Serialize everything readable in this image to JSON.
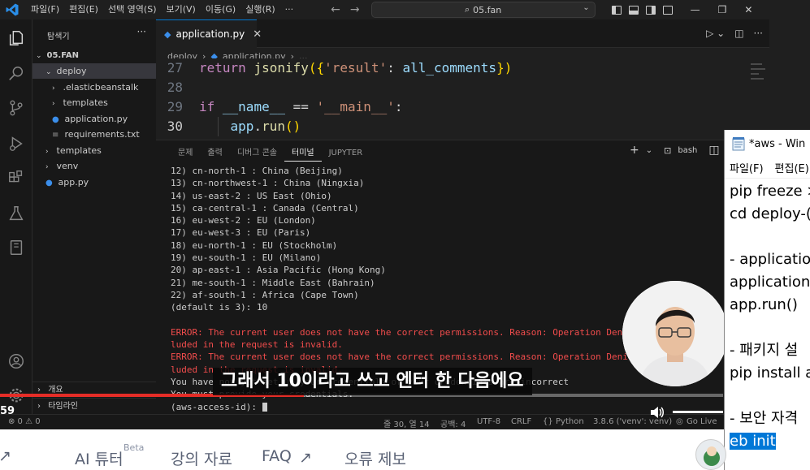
{
  "titlebar": {
    "menu": [
      "파일(F)",
      "편집(E)",
      "선택 영역(S)",
      "보기(V)",
      "이동(G)",
      "실행(R)",
      "···"
    ],
    "search": "05.fan",
    "colors": {
      "background": "#1f1f1f"
    }
  },
  "activity_icons": [
    "explorer-icon",
    "search-icon",
    "source-control-icon",
    "run-debug-icon",
    "extensions-icon",
    "testing-icon",
    "notebook-icon",
    "accounts-icon",
    "settings-gear-icon"
  ],
  "sidebar": {
    "title": "탐색기",
    "more": "···",
    "root": "05.FAN",
    "items": [
      {
        "label": "deploy",
        "type": "folder-open"
      },
      {
        "label": ".elasticbeanstalk",
        "type": "folder"
      },
      {
        "label": "templates",
        "type": "folder"
      },
      {
        "label": "application.py",
        "type": "python"
      },
      {
        "label": "requirements.txt",
        "type": "text"
      },
      {
        "label": "templates",
        "type": "folder"
      },
      {
        "label": "venv",
        "type": "folder"
      },
      {
        "label": "app.py",
        "type": "python"
      }
    ],
    "outline": "개요",
    "timeline": "타임라인"
  },
  "editor": {
    "tab_label": "application.py",
    "tab_icon": "python-icon",
    "breadcrumb": [
      "deploy",
      "application.py",
      "..."
    ],
    "lines": [
      {
        "num": "27",
        "parts": [
          [
            "kw",
            "return "
          ],
          [
            "fn",
            "jsonify"
          ],
          [
            "br",
            "({"
          ],
          [
            "st",
            "'result'"
          ],
          [
            "pl",
            ": "
          ],
          [
            "vr",
            "all_comments"
          ],
          [
            "br",
            "})"
          ]
        ]
      },
      {
        "num": "28",
        "parts": []
      },
      {
        "num": "29",
        "parts": [
          [
            "kw",
            "if "
          ],
          [
            "vr",
            "__name__"
          ],
          [
            "pl",
            " == "
          ],
          [
            "st",
            "'__main__'"
          ],
          [
            "pl",
            ":"
          ]
        ]
      },
      {
        "num": "30",
        "parts": [
          [
            "pl",
            "    "
          ],
          [
            "vr",
            "app"
          ],
          [
            "pl",
            "."
          ],
          [
            "fn",
            "run"
          ],
          [
            "br",
            "()"
          ]
        ]
      }
    ]
  },
  "panel": {
    "tabs": [
      "문제",
      "출력",
      "디버그 콘솔",
      "터미널",
      "JUPYTER"
    ],
    "active_tab": "터미널",
    "shell": "bash",
    "terminal_lines": [
      {
        "t": "12) cn-north-1 : China (Beijing)",
        "c": "n"
      },
      {
        "t": "13) cn-northwest-1 : China (Ningxia)",
        "c": "n"
      },
      {
        "t": "14) us-east-2 : US East (Ohio)",
        "c": "n"
      },
      {
        "t": "15) ca-central-1 : Canada (Central)",
        "c": "n"
      },
      {
        "t": "16) eu-west-2 : EU (London)",
        "c": "n"
      },
      {
        "t": "17) eu-west-3 : EU (Paris)",
        "c": "n"
      },
      {
        "t": "18) eu-north-1 : EU (Stockholm)",
        "c": "n"
      },
      {
        "t": "19) eu-south-1 : EU (Milano)",
        "c": "n"
      },
      {
        "t": "20) ap-east-1 : Asia Pacific (Hong Kong)",
        "c": "n"
      },
      {
        "t": "21) me-south-1 : Middle East (Bahrain)",
        "c": "n"
      },
      {
        "t": "22) af-south-1 : Africa (Cape Town)",
        "c": "n"
      },
      {
        "t": "(default is 3): 10",
        "c": "n"
      },
      {
        "t": "",
        "c": "n"
      },
      {
        "t": "ERROR: The current user does not have the correct permissions. Reason: Operation Denied",
        "c": "err"
      },
      {
        "t": "luded in the request is invalid.",
        "c": "err"
      },
      {
        "t": "ERROR: The current user does not have the correct permissions. Reason: Operation Denied",
        "c": "err"
      },
      {
        "t": "luded in the request is invalid.",
        "c": "err"
      },
      {
        "t": "You have not yet set up your credentials or your credentials are incorrect",
        "c": "n"
      },
      {
        "t": "You must provide your credentials.",
        "c": "n"
      },
      {
        "t": "(aws-access-id): ",
        "c": "n"
      }
    ]
  },
  "statusbar": {
    "problems": "⊗ 0 ⚠ 0",
    "position": "줄 30, 열 14",
    "spaces": "공백: 4",
    "encoding": "UTF-8",
    "eol": "CRLF",
    "language": "Python",
    "interpreter": "3.8.6 ('venv': venv)",
    "golive": "Go Live"
  },
  "video": {
    "caption": "그래서 10이라고 쓰고 엔터 한 다음에요",
    "time": "59",
    "progress": 0.42
  },
  "notepad": {
    "title": "*aws - Win",
    "menu": [
      "파일(F)",
      "편집(E)"
    ],
    "lines": [
      "pip freeze >",
      "cd deploy-(",
      "",
      "- application",
      "application",
      "app.run()",
      "",
      "- 패키지 설",
      "pip install a",
      "",
      "- 보안 자격"
    ],
    "selected": "eb init"
  },
  "webbar": {
    "items": [
      "↗",
      "AI 튜터",
      "강의 자료",
      "FAQ",
      "오류 제보"
    ],
    "beta": "Beta"
  }
}
